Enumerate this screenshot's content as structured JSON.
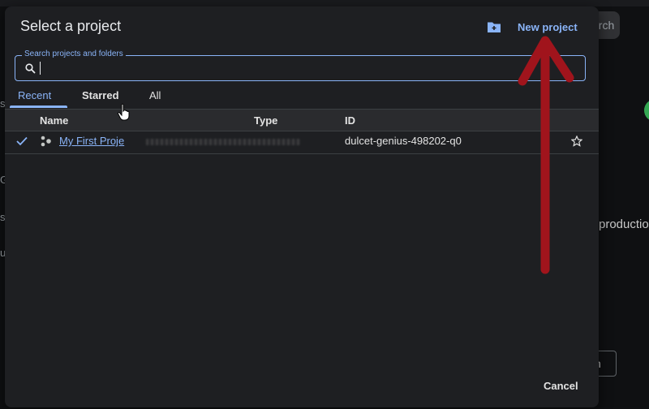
{
  "background": {
    "search_fragment": "arch",
    "production_fragment": "productio",
    "button_fragment": "n",
    "left_chars": [
      "s",
      "G",
      "s",
      "u"
    ]
  },
  "dialog": {
    "title": "Select a project",
    "new_project_label": "New project",
    "search": {
      "label": "Search projects and folders",
      "value": "",
      "placeholder": ""
    },
    "tabs": [
      {
        "label": "Recent",
        "active": true
      },
      {
        "label": "Starred",
        "active": false
      },
      {
        "label": "All",
        "active": false
      }
    ],
    "table": {
      "columns": [
        "Name",
        "Type",
        "ID"
      ],
      "rows": [
        {
          "selected": true,
          "name": "My First Proje",
          "type": "",
          "id": "dulcet-genius-498202-q0",
          "starred": false
        }
      ]
    },
    "cancel_label": "Cancel"
  },
  "colors": {
    "accent": "#8ab4f8",
    "dialog_bg": "#1e1f22",
    "annotation_arrow": "#a0141c"
  },
  "icons": [
    "folder-add-icon",
    "search-icon",
    "check-icon",
    "project-icon",
    "star-outline-icon",
    "hand-cursor-icon"
  ]
}
